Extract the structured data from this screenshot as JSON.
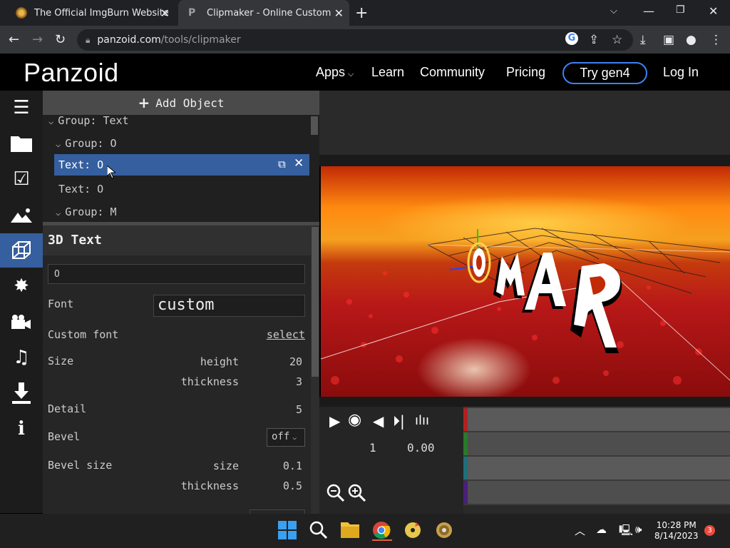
{
  "browser": {
    "tabs": [
      {
        "title": "The Official ImgBurn Website",
        "active": false
      },
      {
        "title": "Clipmaker - Online Custom Intro Maker",
        "active": true
      }
    ],
    "url_host": "panzoid.com",
    "url_path": "/tools/clipmaker"
  },
  "site": {
    "logo": "Panzoid",
    "nav": {
      "apps": "Apps",
      "learn": "Learn",
      "community": "Community",
      "pricing": "Pricing",
      "try": "Try gen4",
      "login": "Log In"
    }
  },
  "sidebar": {
    "items": [
      "menu-icon",
      "folder-icon",
      "checkbox-icon",
      "image-icon",
      "cube-icon",
      "burst-icon",
      "camera-icon",
      "music-icon",
      "download-icon",
      "info-icon"
    ],
    "active_index": 4
  },
  "objects": {
    "add_label": "Add Object",
    "tree": [
      {
        "label": "Group: Text",
        "type": "group"
      },
      {
        "label": "Group: O",
        "type": "group"
      },
      {
        "label": "Text: O",
        "type": "item",
        "selected": true
      },
      {
        "label": "Text: O",
        "type": "item"
      },
      {
        "label": "Group: M",
        "type": "group"
      }
    ]
  },
  "properties": {
    "title": "3D Text",
    "text_value": "O",
    "font_label": "Font",
    "font_value": "custom",
    "custom_font_label": "Custom font",
    "custom_font_action": "select",
    "size_label": "Size",
    "height_label": "height",
    "height_value": "20",
    "thickness_label": "thickness",
    "thickness_value": "3",
    "detail_label": "Detail",
    "detail_value": "5",
    "bevel_label": "Bevel",
    "bevel_value": "off",
    "bevel_size_label": "Bevel size",
    "bevel_size_sub": "size",
    "bevel_size_value": "0.1",
    "bevel_thickness_label": "thickness",
    "bevel_thickness_value": "0.5"
  },
  "preview": {
    "text": "OMAR"
  },
  "timeline": {
    "frame": "1",
    "time": "0.00",
    "track_colors": [
      "#b32020",
      "#2a7a2a",
      "#1f6f7a",
      "#4a1f7a"
    ]
  },
  "taskbar": {
    "time": "10:28 PM",
    "date": "8/14/2023",
    "notifications": "3"
  }
}
